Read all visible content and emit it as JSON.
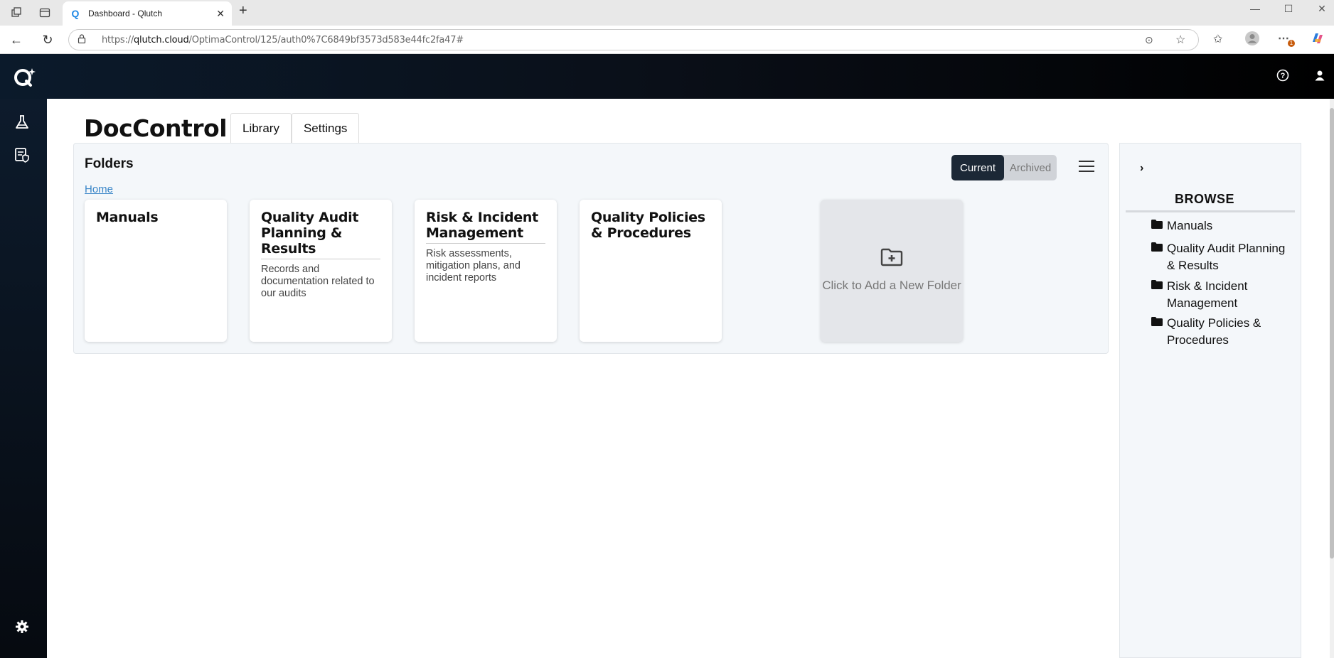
{
  "browser": {
    "tab_title": "Dashboard - Qlutch",
    "url_prefix": "https://",
    "url_domain": "qlutch.cloud",
    "url_path": "/OptimaControl/125/auth0%7C6849bf3573d583e44fc2fa47#",
    "badge_count": "1"
  },
  "page": {
    "title": "DocControl",
    "tabs": [
      {
        "label": "Library"
      },
      {
        "label": "Settings"
      }
    ]
  },
  "folders_panel": {
    "title": "Folders",
    "breadcrumb": "Home",
    "toggle": {
      "current": "Current",
      "archived": "Archived"
    },
    "cards": [
      {
        "title": "Manuals",
        "description": ""
      },
      {
        "title": "Quality Audit Planning & Results",
        "description": "Records and documentation related to our audits"
      },
      {
        "title": "Risk & Incident Management",
        "description": "Risk assessments, mitigation plans, and incident reports"
      },
      {
        "title": "Quality Policies & Procedures",
        "description": ""
      }
    ],
    "add_folder_text": "Click to Add a New Folder"
  },
  "browse": {
    "title": "BROWSE",
    "items": [
      {
        "label": "Manuals"
      },
      {
        "label": "Quality Audit Planning & Results"
      },
      {
        "label": "Risk & Incident Management"
      },
      {
        "label": "Quality Policies & Procedures"
      }
    ]
  },
  "colors": {
    "accent_dark": "#1c2836",
    "link": "#3a86c8",
    "sidebar": "#0d1b2c"
  },
  "icons": {
    "sidebar": [
      "flask-icon",
      "document-shield-icon",
      "gear-icon"
    ],
    "header": [
      "help-icon",
      "user-icon"
    ]
  }
}
